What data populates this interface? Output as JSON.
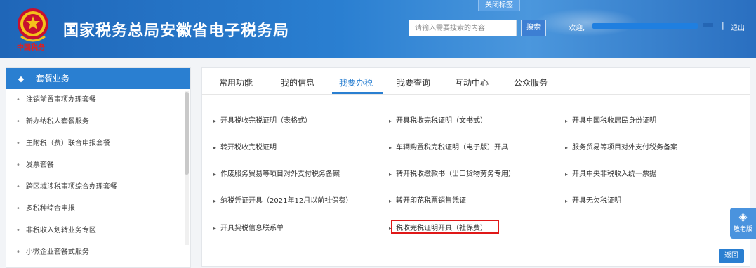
{
  "header": {
    "close_tag": "关闭标签",
    "emblem_text": "中国税务",
    "site_title": "国家税务总局安徽省电子税务局",
    "search_placeholder": "请输入需要搜索的内容",
    "search_button": "搜索",
    "welcome": "欢迎,",
    "divider": "|",
    "logout": "退出"
  },
  "sidebar": {
    "title": "套餐业务",
    "items": [
      {
        "label": "注销前置事项办理套餐"
      },
      {
        "label": "新办纳税人套餐服务"
      },
      {
        "label": "主附税（费）联合申报套餐"
      },
      {
        "label": "发票套餐"
      },
      {
        "label": "跨区域涉税事项综合办理套餐"
      },
      {
        "label": "多税种综合申报"
      },
      {
        "label": "非税收入划转业务专区"
      },
      {
        "label": "小微企业套餐式服务"
      }
    ]
  },
  "main": {
    "tabs": [
      {
        "label": "常用功能"
      },
      {
        "label": "我的信息"
      },
      {
        "label": "我要办税"
      },
      {
        "label": "我要查询"
      },
      {
        "label": "互动中心"
      },
      {
        "label": "公众服务"
      }
    ],
    "active_tab": "我要办税",
    "items": [
      {
        "label": "开具税收完税证明（表格式）"
      },
      {
        "label": "开具税收完税证明（文书式）"
      },
      {
        "label": "开具中国税收居民身份证明"
      },
      {
        "label": "转开税收完税证明"
      },
      {
        "label": "车辆购置税完税证明（电子版）开具"
      },
      {
        "label": "服务贸易等项目对外支付税务备案"
      },
      {
        "label": "作废服务贸易等项目对外支付税务备案"
      },
      {
        "label": "转开税收缴款书（出口货物劳务专用）"
      },
      {
        "label": "开具中央非税收入统一票据"
      },
      {
        "label": "纳税凭证开具（2021年12月以前社保费）"
      },
      {
        "label": "转开印花税票销售凭证"
      },
      {
        "label": "开具无欠税证明"
      },
      {
        "label": "开具契税信息联系单"
      },
      {
        "label": "税收完税证明开具（社保费）"
      }
    ],
    "return_button": "返回"
  },
  "floating": {
    "senior_mode": "敬老版"
  },
  "colors": {
    "brand_blue": "#2a7fd1",
    "highlight_red": "#e01818"
  }
}
